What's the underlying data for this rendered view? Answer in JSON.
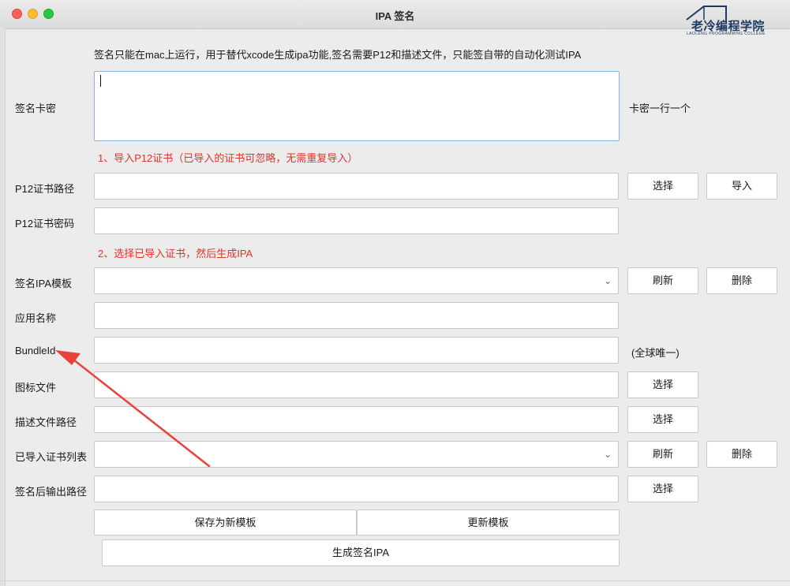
{
  "window": {
    "title": "IPA 签名"
  },
  "logo": {
    "text": "老冷编程学院",
    "subtitle": "LAOLENG PROGRAMMING COLLEGE",
    "color": "#1d3a63"
  },
  "intro": "签名只能在mac上运行，用于替代xcode生成ipa功能,签名需要P12和描述文件，只能签自带的自动化测试IPA",
  "card": {
    "label": "签名卡密",
    "value": "",
    "hint": "卡密一行一个"
  },
  "step1": "1、导入P12证书（已导入的证书可忽略，无需重复导入）",
  "p12_path": {
    "label": "P12证书路径",
    "value": "",
    "select_button": "选择",
    "import_button": "导入"
  },
  "p12_password": {
    "label": "P12证书密码",
    "value": ""
  },
  "step2": "2、选择已导入证书，然后生成IPA",
  "template": {
    "label": "签名IPA模板",
    "selected": "",
    "refresh_button": "刷新",
    "delete_button": "删除"
  },
  "app_name": {
    "label": "应用名称",
    "value": ""
  },
  "bundle_id": {
    "label": "BundleId",
    "value": "",
    "hint": "(全球唯一)"
  },
  "icon_file": {
    "label": "图标文件",
    "value": "",
    "select_button": "选择"
  },
  "profile_path": {
    "label": "描述文件路径",
    "value": "",
    "select_button": "选择"
  },
  "cert_list": {
    "label": "已导入证书列表",
    "selected": "",
    "refresh_button": "刷新",
    "delete_button": "删除"
  },
  "output_path": {
    "label": "签名后输出路径",
    "value": "",
    "select_button": "选择"
  },
  "actions": {
    "save_template": "保存为新模板",
    "update_template": "更新模板",
    "generate": "生成签名IPA"
  },
  "colors": {
    "warning_text": "#e0332b",
    "annotation_arrow": "#e8423a",
    "focus_border": "#8fb2d8"
  },
  "icons": {
    "dropdown": "chevron-down-icon"
  }
}
